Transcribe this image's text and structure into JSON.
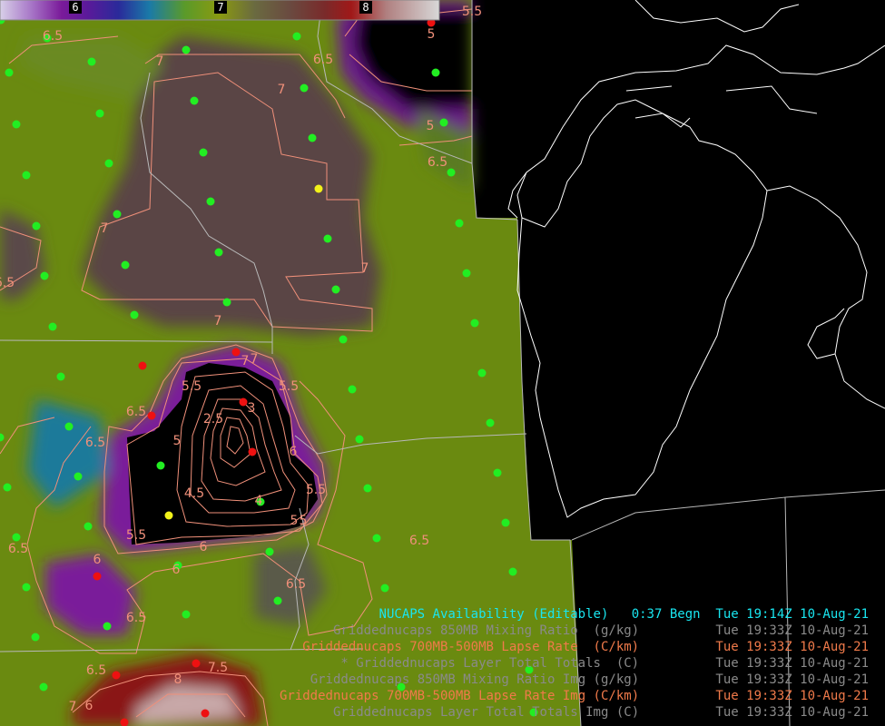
{
  "colorbar": {
    "labels": [
      "6",
      "7",
      "8"
    ]
  },
  "contour_labels": [
    "6.5",
    "7",
    "6.5",
    "5",
    "5.5",
    "7",
    "6.5",
    "5",
    "7",
    "7",
    "6.5",
    "7",
    "7",
    "7",
    "5.5",
    "5.5",
    "6.5",
    "2.5",
    "3",
    "5",
    "6",
    "6.5",
    "5",
    "4.5",
    "4",
    "5.5",
    "5",
    "5.5",
    "6",
    "6",
    "6",
    "6.5",
    "6.5",
    "6.5",
    "6.5",
    "6.5",
    "7.5",
    "8",
    "7",
    "6"
  ],
  "legend": [
    {
      "name": "NUCAPS Availability (Editable)",
      "status": "0:37 Begn",
      "time": "Tue 19:14Z 10-Aug-21",
      "color": "#19e6f0"
    },
    {
      "name": "Griddednucaps 850MB Mixing Ratio  (g/kg)",
      "status": "",
      "time": "Tue 19:33Z 10-Aug-21",
      "color": "#8a8a8a"
    },
    {
      "name": "Griddednucaps 700MB-500MB Lapse Rate  (C/km)",
      "status": "",
      "time": "Tue 19:33Z 10-Aug-21",
      "color": "#f07a4a"
    },
    {
      "name": "* Griddednucaps Layer Total Totals  (C)",
      "status": "",
      "time": "Tue 19:33Z 10-Aug-21",
      "color": "#8a8a8a"
    },
    {
      "name": "Griddednucaps 850MB Mixing Ratio Img (g/kg)",
      "status": "",
      "time": "Tue 19:33Z 10-Aug-21",
      "color": "#8a8a8a"
    },
    {
      "name": "Griddednucaps 700MB-500MB Lapse Rate Img (C/km)",
      "status": "",
      "time": "Tue 19:33Z 10-Aug-21",
      "color": "#f07a4a"
    },
    {
      "name": "Griddednucaps Layer Total Totals Img (C)",
      "status": "",
      "time": "Tue 19:33Z 10-Aug-21",
      "color": "#8a8a8a"
    }
  ],
  "colors": {
    "green_field": "#6a8a10",
    "brown_field": "#5e4440",
    "purple": "#7a1a8a",
    "contour": "#f0907a",
    "obs_green": "#22ee22",
    "obs_red": "#ee1111",
    "obs_yellow": "#f2f21a",
    "border": "#bcbcbc"
  }
}
